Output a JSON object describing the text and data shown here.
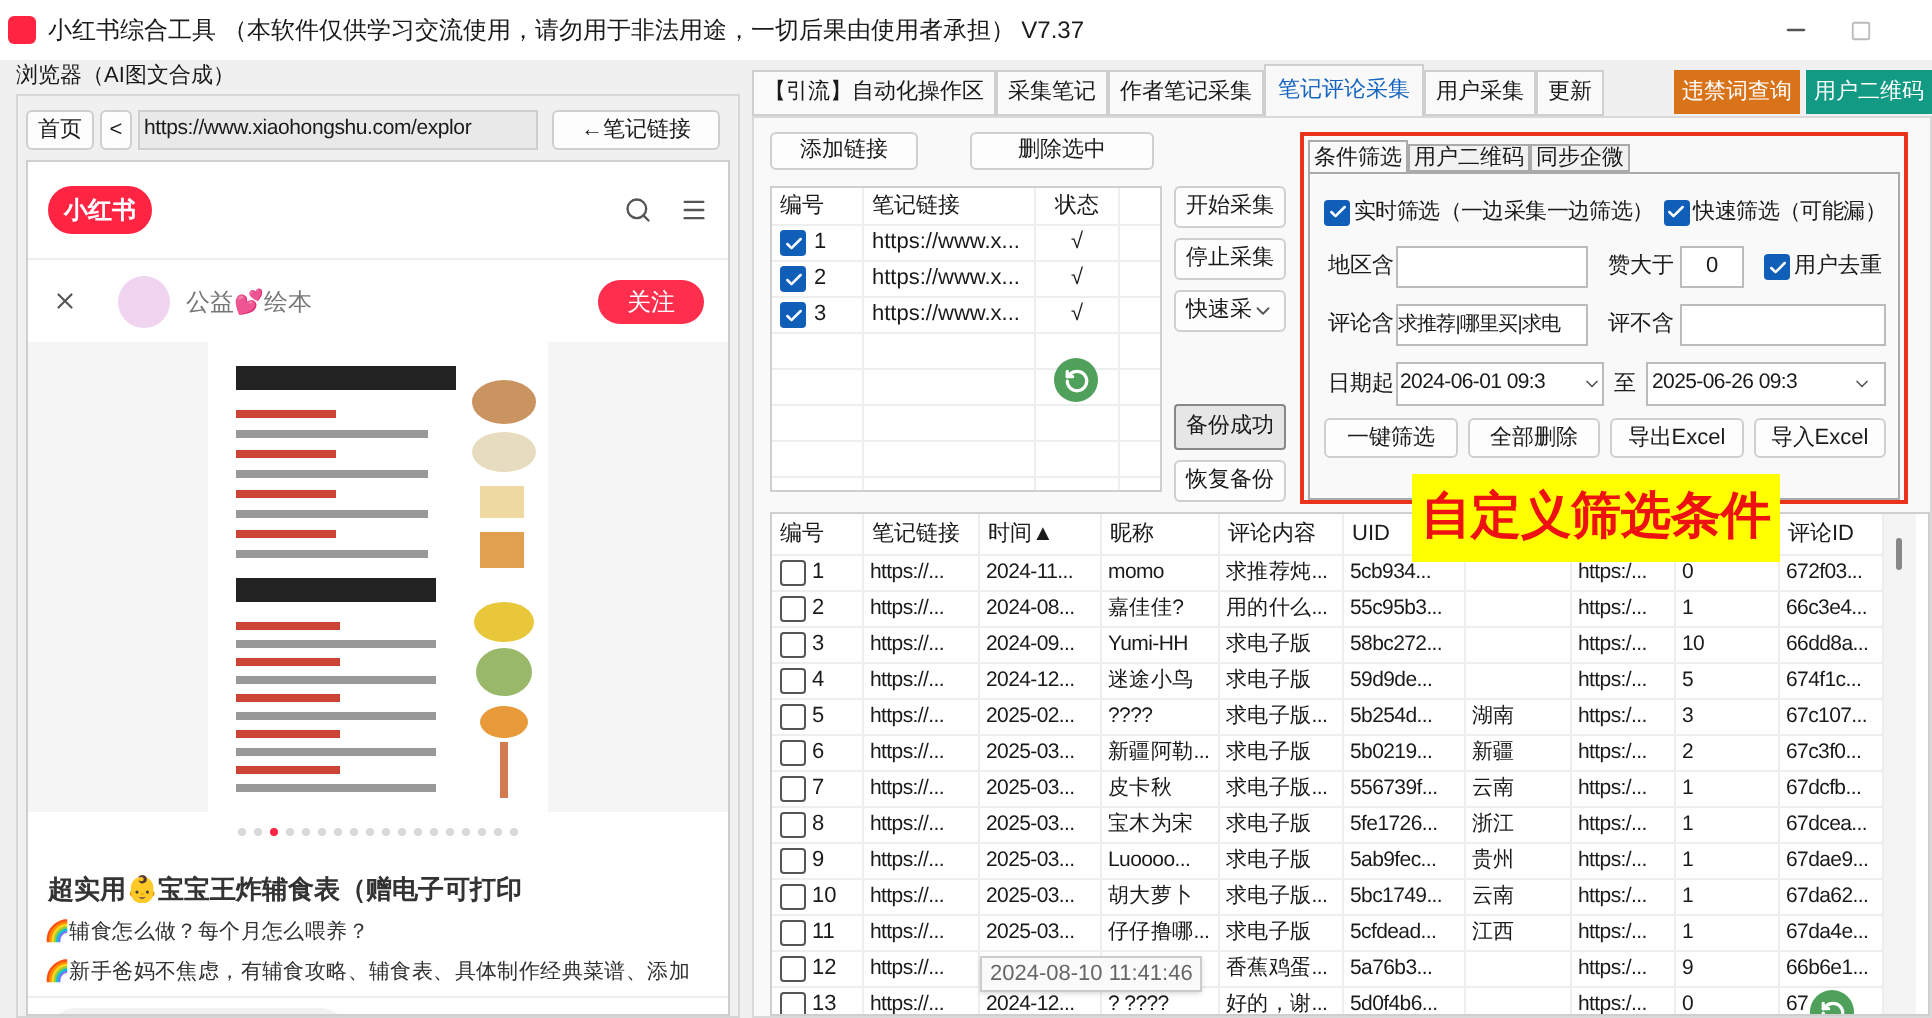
{
  "window": {
    "title": "小红书综合工具 （本软件仅供学习交流使用，请勿用于非法用途，一切后果由使用者承担） V7.37"
  },
  "browser": {
    "group_title": "浏览器（AI图文合成）",
    "home_button": "首页",
    "back_button": "<",
    "url": "https://www.xiaohongshu.com/explor",
    "note_link_button": "←笔记链接",
    "page": {
      "logo": "小红书",
      "author": "公益💕绘本",
      "follow_button": "关注",
      "dots": [
        false,
        false,
        true,
        false,
        false,
        false,
        false,
        false,
        false,
        false,
        false,
        false,
        false,
        false,
        false,
        false,
        false,
        false
      ],
      "title": "超实用👶宝宝王炸辅食表（赠电子可打印",
      "lines": [
        "🌈辅食怎么做？每个月怎么喂养？",
        "🌈新手爸妈不焦虑，有辅食攻略、辅食表、具体制作经典菜谱、添加"
      ]
    }
  },
  "tabs": [
    {
      "label": "【引流】自动化操作区",
      "selected": false
    },
    {
      "label": "采集笔记",
      "selected": false
    },
    {
      "label": "作者笔记采集",
      "selected": false
    },
    {
      "label": "笔记评论采集",
      "selected": true
    },
    {
      "label": "用户采集",
      "selected": false
    },
    {
      "label": "更新",
      "selected": false
    }
  ],
  "top_buttons": [
    {
      "label": "违禁词查询",
      "color": "#d9731a"
    },
    {
      "label": "用户二维码",
      "color": "#139a84"
    }
  ],
  "links": {
    "add_button": "添加链接",
    "delete_button": "删除选中",
    "columns": [
      "编号",
      "笔记链接",
      "状态"
    ],
    "rows": [
      {
        "checked": true,
        "number": "1",
        "link": "https://www.x...",
        "status": "√"
      },
      {
        "checked": true,
        "number": "2",
        "link": "https://www.x...",
        "status": "√"
      },
      {
        "checked": true,
        "number": "3",
        "link": "https://www.x...",
        "status": "√"
      }
    ]
  },
  "actions": [
    {
      "label": "开始采集",
      "kind": "button"
    },
    {
      "label": "停止采集",
      "kind": "button"
    },
    {
      "label": "快速采",
      "kind": "dropdown"
    },
    {
      "label": "备份成功",
      "kind": "pressed"
    },
    {
      "label": "恢复备份",
      "kind": "button"
    }
  ],
  "filter": {
    "tabs": [
      {
        "label": "条件筛选",
        "selected": true
      },
      {
        "label": "用户二维码",
        "selected": false
      },
      {
        "label": "同步企微",
        "selected": false
      }
    ],
    "realtime": {
      "label": "实时筛选（一边采集一边筛选）",
      "checked": true
    },
    "quick": {
      "label": "快速筛选（可能漏）",
      "checked": true
    },
    "region_label": "地区含",
    "likes_label": "赞大于",
    "likes_value": "0",
    "dedupe": {
      "label": "用户去重",
      "checked": true
    },
    "comment_label": "评论含",
    "comment_value": "求推荐|哪里买|求电",
    "exclude_label": "评不含",
    "date_from_label": "日期起",
    "date_from": "2024-06-01 09:3",
    "to_label": "至",
    "date_to": "2025-06-26 09:3",
    "buttons": [
      "一键筛选",
      "全部删除",
      "导出Excel",
      "导入Excel"
    ]
  },
  "callout": "自定义筛选条件",
  "comments": {
    "columns": [
      {
        "label": "编号"
      },
      {
        "label": "笔记链接"
      },
      {
        "label": "时间▲"
      },
      {
        "label": "昵称"
      },
      {
        "label": "评论内容"
      },
      {
        "label": "UID"
      },
      {},
      {},
      {},
      {
        "label": "评论ID"
      }
    ],
    "tooltip": "2024-08-10 11:41:46",
    "rows": [
      {
        "checked": false,
        "cells": [
          "1",
          "https://...",
          "2024-11...",
          "momo",
          "求推荐炖...",
          "5cb934...",
          null,
          "https:/...",
          "0",
          "672f03..."
        ]
      },
      {
        "checked": false,
        "cells": [
          "2",
          "https://...",
          "2024-08...",
          "嘉佳佳?",
          "用的什么...",
          "55c95b3...",
          null,
          "https:/...",
          "1",
          "66c3e4..."
        ]
      },
      {
        "checked": false,
        "cells": [
          "3",
          "https://...",
          "2024-09...",
          "Yumi-HH",
          "求电子版",
          "58bc272...",
          null,
          "https:/...",
          "10",
          "66dd8a..."
        ]
      },
      {
        "checked": false,
        "cells": [
          "4",
          "https://...",
          "2024-12...",
          "迷途小鸟",
          "求电子版",
          "59d9de...",
          null,
          "https:/...",
          "5",
          "674f1c..."
        ]
      },
      {
        "checked": false,
        "cells": [
          "5",
          "https://...",
          "2025-02...",
          "????",
          "求电子版...",
          "5b254d...",
          "湖南",
          "https:/...",
          "3",
          "67c107..."
        ]
      },
      {
        "checked": false,
        "cells": [
          "6",
          "https://...",
          "2025-03...",
          "新疆阿勒...",
          "求电子版",
          "5b0219...",
          "新疆",
          "https:/...",
          "2",
          "67c3f0..."
        ]
      },
      {
        "checked": false,
        "cells": [
          "7",
          "https://...",
          "2025-03...",
          "皮卡秋",
          "求电子版...",
          "556739f...",
          "云南",
          "https:/...",
          "1",
          "67dcfb..."
        ]
      },
      {
        "checked": false,
        "cells": [
          "8",
          "https://...",
          "2025-03...",
          "宝木为宋",
          "求电子版",
          "5fe1726...",
          "浙江",
          "https:/...",
          "1",
          "67dcea..."
        ]
      },
      {
        "checked": false,
        "cells": [
          "9",
          "https://...",
          "2025-03...",
          "Luoooo...",
          "求电子版",
          "5ab9fec...",
          "贵州",
          "https:/...",
          "1",
          "67dae9..."
        ]
      },
      {
        "checked": false,
        "cells": [
          "10",
          "https://...",
          "2025-03...",
          "胡大萝卜",
          "求电子版...",
          "5bc1749...",
          "云南",
          "https:/...",
          "1",
          "67da62..."
        ]
      },
      {
        "checked": false,
        "cells": [
          "11",
          "https://...",
          "2025-03...",
          "仔仔撸哪...",
          "求电子版",
          "5cfdead...",
          "江西",
          "https:/...",
          "1",
          "67da4e..."
        ]
      },
      {
        "checked": false,
        "cells": [
          "12",
          "https://...",
          null,
          null,
          "香蕉鸡蛋...",
          "5a76b3...",
          null,
          "https:/...",
          "9",
          "66b6e1..."
        ]
      },
      {
        "checked": false,
        "cells": [
          "13",
          "https://...",
          "2024-12...",
          "? ????",
          "好的，谢...",
          "5d0f4b6...",
          null,
          "https:/...",
          "0",
          "67"
        ]
      }
    ]
  }
}
